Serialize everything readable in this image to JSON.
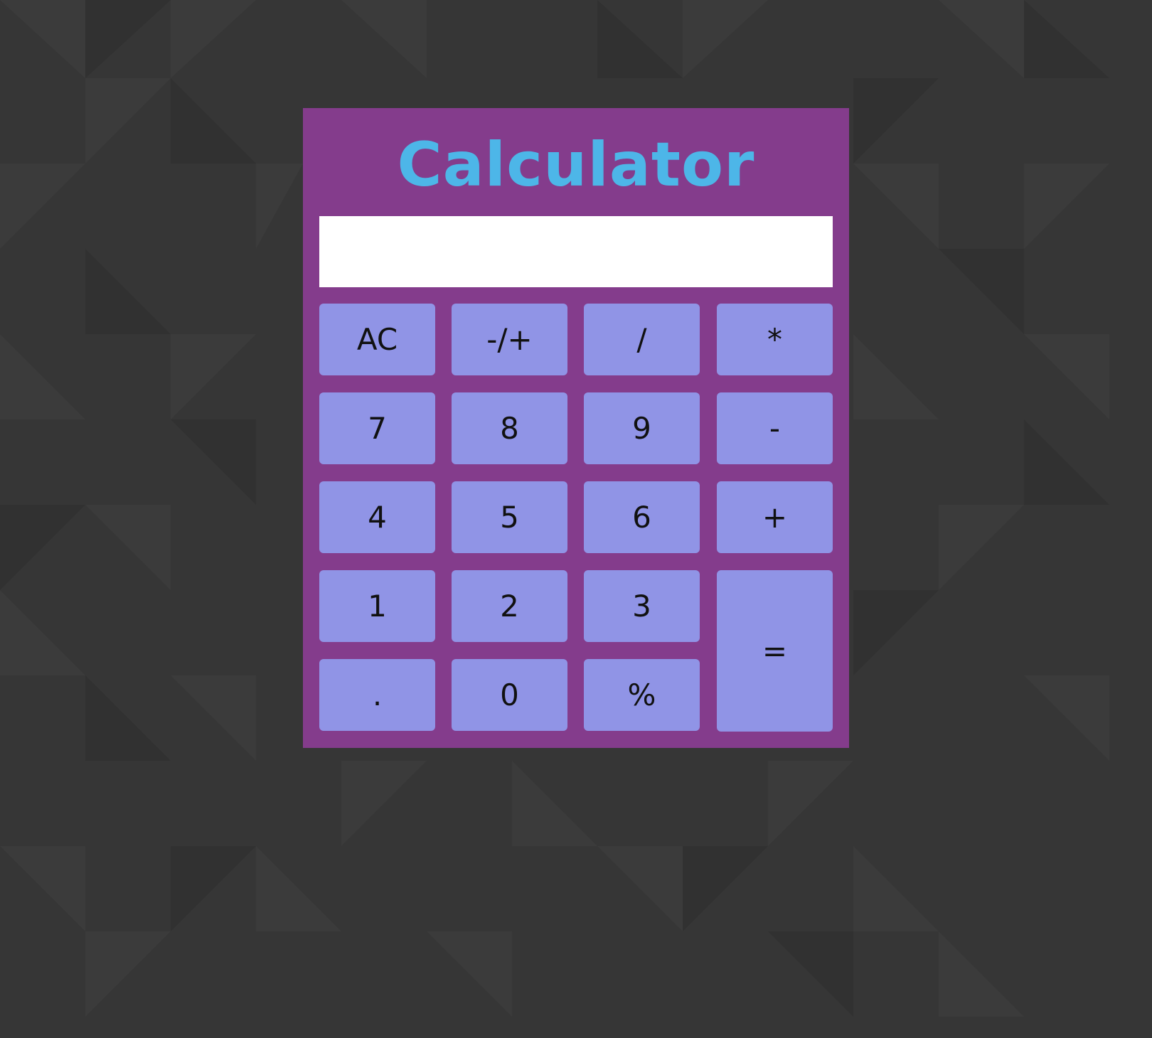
{
  "calculator": {
    "title": "Calculator",
    "display_value": "",
    "keys": [
      {
        "label": "AC",
        "name": "clear-button"
      },
      {
        "label": "-/+",
        "name": "toggle-sign-button"
      },
      {
        "label": "/",
        "name": "divide-button"
      },
      {
        "label": "*",
        "name": "multiply-button"
      },
      {
        "label": "7",
        "name": "digit-7-button"
      },
      {
        "label": "8",
        "name": "digit-8-button"
      },
      {
        "label": "9",
        "name": "digit-9-button"
      },
      {
        "label": "-",
        "name": "subtract-button"
      },
      {
        "label": "4",
        "name": "digit-4-button"
      },
      {
        "label": "5",
        "name": "digit-5-button"
      },
      {
        "label": "6",
        "name": "digit-6-button"
      },
      {
        "label": "+",
        "name": "add-button"
      },
      {
        "label": "1",
        "name": "digit-1-button"
      },
      {
        "label": "2",
        "name": "digit-2-button"
      },
      {
        "label": "3",
        "name": "digit-3-button"
      },
      {
        "label": "=",
        "name": "equals-button"
      },
      {
        "label": ".",
        "name": "decimal-button"
      },
      {
        "label": "0",
        "name": "digit-0-button"
      },
      {
        "label": "%",
        "name": "percent-button"
      }
    ]
  },
  "colors": {
    "page_background": "#363636",
    "calculator_body": "#843c8c",
    "title_text": "#4db6e8",
    "key_background": "#9094e6",
    "display_background": "#ffffff"
  }
}
